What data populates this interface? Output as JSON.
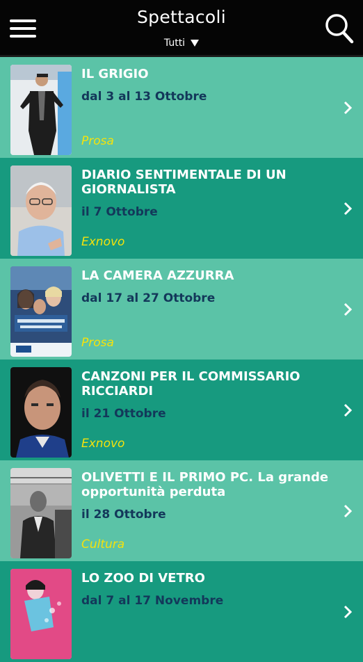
{
  "header": {
    "title": "Spettacoli",
    "filter_label": "Tutti",
    "menu_icon": "menu-icon",
    "search_icon": "search-icon"
  },
  "events": [
    {
      "title": "IL GRIGIO",
      "date": "dal 3 al 13 Ottobre",
      "category": "Prosa",
      "theme": "light"
    },
    {
      "title": "DIARIO SENTIMENTALE DI UN GIORNALISTA",
      "date": "il 7 Ottobre",
      "category": "Exnovo",
      "theme": "dark"
    },
    {
      "title": "LA CAMERA AZZURRA",
      "date": "dal 17 al 27 Ottobre",
      "category": "Prosa",
      "theme": "light"
    },
    {
      "title": "CANZONI PER IL COMMISSARIO RICCIARDI",
      "date": "il 21 Ottobre",
      "category": "Exnovo",
      "theme": "dark"
    },
    {
      "title": "OLIVETTI E IL PRIMO PC. La grande opportunità perduta",
      "date": "il 28 Ottobre",
      "category": "Cultura",
      "theme": "light"
    },
    {
      "title": "LO ZOO DI VETRO",
      "date": "dal 7 al 17 Novembre",
      "category": "",
      "theme": "dark"
    }
  ],
  "colors": {
    "header_bg": "#050505",
    "row_light": "#5bc3a7",
    "row_dark": "#179a7f",
    "title_text": "#ffffff",
    "date_text": "#13385a",
    "category_text": "#f4e20c"
  }
}
